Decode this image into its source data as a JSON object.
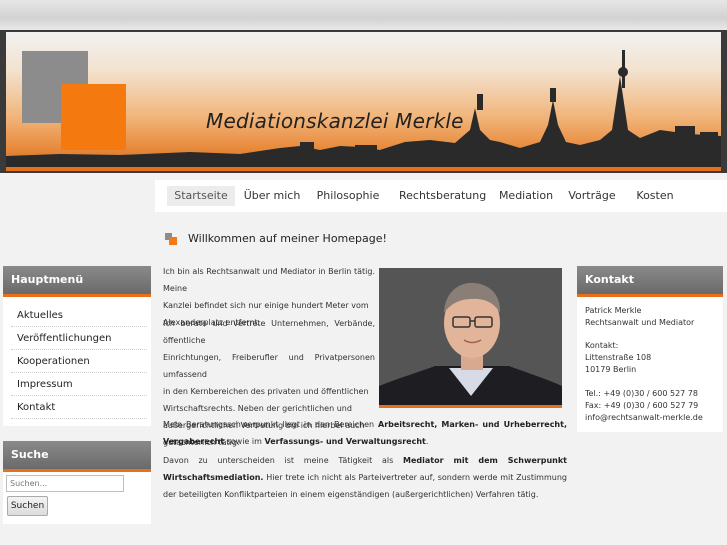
{
  "banner": {
    "title": "Mediationskanzlei Merkle"
  },
  "nav": {
    "items": [
      "Startseite",
      "Über mich",
      "Philosophie",
      "Rechtsberatung",
      "Mediation",
      "Vorträge",
      "Kosten"
    ],
    "active_index": 0
  },
  "sidebar": {
    "main_menu_title": "Hauptmenü",
    "main_menu_items": [
      "Aktuelles",
      "Veröffentlichungen",
      "Kooperationen",
      "Impressum",
      "Kontakt"
    ],
    "search_title": "Suche",
    "search_placeholder": "Suchen...",
    "search_button": "Suchen"
  },
  "content": {
    "welcome": "Willkommen auf meiner Homepage!",
    "p1_lines": [
      "Ich bin als Rechtsanwalt und Mediator in Berlin tätig. Meine",
      "Kanzlei befindet sich nur einige hundert Meter vom",
      "Alexanderplatz entfernt."
    ],
    "p2_lines": [
      "Ich berate und vertrete Unternehmen, Verbände, öffentliche",
      "Einrichtungen, Freiberufler und Privatpersonen umfassend",
      "in den Kernbereichen des privaten und öffentlichen",
      "Wirtschaftsrechts. Neben der gerichtlichen und",
      "außergerichtlichen Vertretung bin ich hierbei auch",
      "gutachterlich tätig."
    ],
    "p3_pre": "Mein Beratungsschwerpunkt liegt in den Bereichen ",
    "p3_bold1": "Arbeitsrecht, Marken- und Urheberrecht, Vergaberecht",
    "p3_mid": " sowie im ",
    "p3_bold2": "Verfassungs- und Verwaltungsrecht",
    "p3_end": ".",
    "p4_pre": "Davon zu unterscheiden ist meine Tätigkeit als ",
    "p4_bold": "Mediator mit dem Schwerpunkt Wirtschaftsmediation.",
    "p4_rest": " Hier trete ich nicht als Parteivertreter auf, sondern werde mit Zustimmung der beteiligten Konfliktparteien in einem eigenständigen (außergerichtlichen) Verfahren tätig."
  },
  "contact": {
    "title": "Kontakt",
    "name": "Patrick Merkle",
    "role": "Rechtsanwalt und Mediator",
    "address_label": "Kontakt:",
    "street": "Littenstraße 108",
    "city": "10179 Berlin",
    "tel": "Tel.: +49 (0)30 / 600 527 78",
    "fax": "Fax: +49 (0)30 / 600 527 79",
    "email": "info@rechtsanwalt-merkle.de"
  },
  "colors": {
    "accent": "#e8701a",
    "header_gray": "#777777",
    "logo_gray": "#8c8c8c",
    "logo_orange": "#f47a10"
  }
}
